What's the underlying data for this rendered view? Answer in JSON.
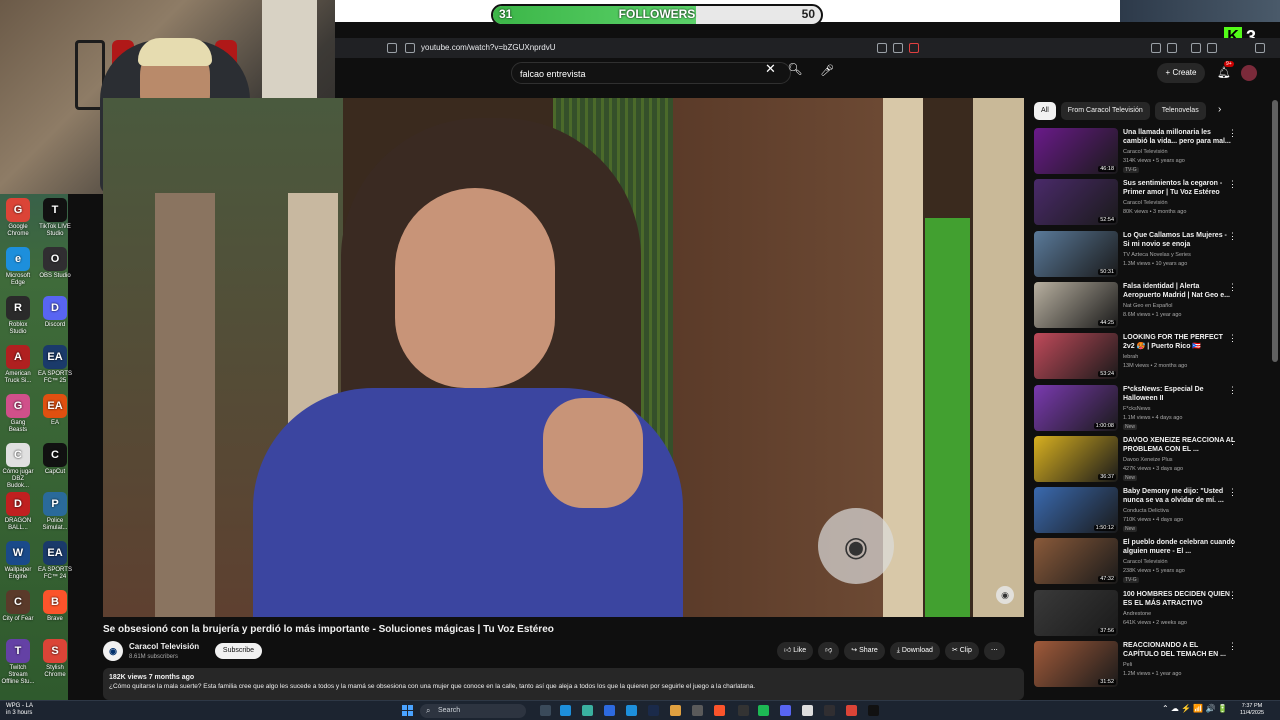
{
  "overlay": {
    "followers_label": "FOLLOWERS",
    "followers_current": "31",
    "followers_goal": "50",
    "followers_progress": 0.62,
    "kick_count": "3"
  },
  "browser": {
    "url": "youtube.com/watch?v=bZGUXnprdvU"
  },
  "youtube": {
    "search_value": "falcao entrevista",
    "create_label": "Create",
    "notif_count": "9+"
  },
  "video": {
    "title": "Se obsesionó con la brujería y perdió lo más importante - Soluciones mágicas | Tu Voz Estéreo",
    "channel": "Caracol Televisión",
    "subscribers": "8.61M subscribers",
    "subscribe_label": "Subscribe",
    "actions": {
      "like": "Like",
      "share": "Share",
      "download": "Download",
      "clip": "Clip"
    },
    "meta": "182K views  7 months ago",
    "description": "¿Cómo quitarse la mala suerte? Esta familia cree que algo les sucede a todos y la mamá se obsesiona con una mujer que conoce en la calle, tanto así que aleja a todos los que la quieren por seguirle el juego a la charlatana."
  },
  "sidebar": {
    "chips": [
      "All",
      "From Caracol Televisión",
      "Telenovelas"
    ],
    "recommendations": [
      {
        "title": "Una llamada millonaria les cambió la vida... pero para mal...",
        "channel": "Caracol Televisión",
        "meta": "314K views • 5 years ago",
        "badge": "TV-G",
        "duration": "46:18",
        "color": "#6a1a8a"
      },
      {
        "title": "Sus sentimientos la cegaron - Primer amor | Tu Voz Estéreo",
        "channel": "Caracol Televisión",
        "meta": "80K views • 3 months ago",
        "badge": "",
        "duration": "52:54",
        "color": "#4a2a6a"
      },
      {
        "title": "Lo Que Callamos Las Mujeres - Si mi novio se enoja",
        "channel": "TV Azteca Novelas y Series",
        "meta": "1.3M views • 10 years ago",
        "badge": "",
        "duration": "50:31",
        "color": "#5a7a9a"
      },
      {
        "title": "Falsa identidad | Alerta Aeropuerto Madrid | Nat Geo e...",
        "channel": "Nat Geo en Español",
        "meta": "8.6M views • 1 year ago",
        "badge": "",
        "duration": "44:25",
        "color": "#b8b0a0"
      },
      {
        "title": "LOOKING FOR THE PERFECT 2v2 🥵 | Puerto Rico 🇵🇷",
        "channel": "lebrah",
        "meta": "13M views • 2 months ago",
        "badge": "",
        "duration": "53:24",
        "color": "#c04a5a"
      },
      {
        "title": "F*cksNews: Especial De Halloween II",
        "channel": "F*cksNews",
        "meta": "1.1M views • 4 days ago",
        "badge": "New",
        "duration": "1:00:08",
        "color": "#7a3ab0"
      },
      {
        "title": "DAVOO XENEIZE REACCIONA AL PROBLEMA CON EL ...",
        "channel": "Davoo Xeneize Plus",
        "meta": "427K views • 3 days ago",
        "badge": "New",
        "duration": "36:37",
        "color": "#d8b020"
      },
      {
        "title": "Baby Demony me dijo: \"Usted nunca se va a olvidar de mí. ...",
        "channel": "Conducta Delictiva",
        "meta": "710K views • 4 days ago",
        "badge": "New",
        "duration": "1:50:12",
        "color": "#3a6ab0"
      },
      {
        "title": "El pueblo donde celebran cuando alguien muere - El ...",
        "channel": "Caracol Televisión",
        "meta": "238K views • 5 years ago",
        "badge": "TV-G",
        "duration": "47:32",
        "color": "#8a5a3a"
      },
      {
        "title": "100 HOMBRES DECIDEN QUIEN ES EL MÁS ATRACTIVO",
        "channel": "Andrestone",
        "meta": "641K views • 2 weeks ago",
        "badge": "",
        "duration": "37:56",
        "color": "#3a3a3a"
      },
      {
        "title": "REACCIONANDO A EL CAPÍTULO DEL TEMACH EN ...",
        "channel": "Peli",
        "meta": "1.2M views • 1 year ago",
        "badge": "",
        "duration": "31:52",
        "color": "#a05a3a"
      }
    ]
  },
  "desktop_icons": [
    {
      "label": "Google Chrome",
      "glyph": "G",
      "color": "#db4437"
    },
    {
      "label": "TikTok LIVE Studio",
      "glyph": "T",
      "color": "#111111"
    },
    {
      "label": "Microsoft Edge",
      "glyph": "e",
      "color": "#1d8fdc"
    },
    {
      "label": "OBS Studio",
      "glyph": "O",
      "color": "#302e31"
    },
    {
      "label": "Roblox Studio",
      "glyph": "R",
      "color": "#2a2a2a"
    },
    {
      "label": "Discord",
      "glyph": "D",
      "color": "#5865f2"
    },
    {
      "label": "American Truck Si...",
      "glyph": "A",
      "color": "#b02020"
    },
    {
      "label": "EA SPORTS FC™ 25",
      "glyph": "EA",
      "color": "#1a3a6a"
    },
    {
      "label": "Gang Beasts",
      "glyph": "G",
      "color": "#d0508a"
    },
    {
      "label": "EA",
      "glyph": "EA",
      "color": "#e05010"
    },
    {
      "label": "Cómo jugar DBZ Budok...",
      "glyph": "C",
      "color": "#e0e0e0"
    },
    {
      "label": "CapCut",
      "glyph": "C",
      "color": "#111111"
    },
    {
      "label": "DRAGON BALL...",
      "glyph": "D",
      "color": "#c02020"
    },
    {
      "label": "Police Simulat...",
      "glyph": "P",
      "color": "#2a6a9a"
    },
    {
      "label": "Wallpaper Engine",
      "glyph": "W",
      "color": "#1a4a8a"
    },
    {
      "label": "EA SPORTS FC™ 24",
      "glyph": "EA",
      "color": "#1a3a6a"
    },
    {
      "label": "City of Fear",
      "glyph": "C",
      "color": "#5a3a2a"
    },
    {
      "label": "Brave",
      "glyph": "B",
      "color": "#fb542b"
    },
    {
      "label": "Twitch Stream Offline Stu...",
      "glyph": "T",
      "color": "#6441a5"
    },
    {
      "label": "Stylish Chrome",
      "glyph": "S",
      "color": "#db4437"
    }
  ],
  "taskbar": {
    "weather_temp": "WPG - LA",
    "weather_sub": "in 3 hours",
    "search_label": "Search",
    "time": "7:37 PM",
    "date": "11/4/2025"
  }
}
